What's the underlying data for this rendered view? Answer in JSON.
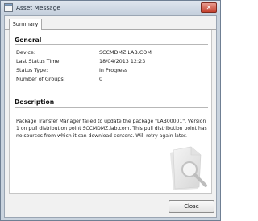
{
  "window": {
    "title": "Asset Message"
  },
  "tabs": [
    {
      "label": "Summary"
    }
  ],
  "general": {
    "heading": "General",
    "fields": [
      {
        "label": "Device:",
        "value": "SCCMDMZ.LAB.COM"
      },
      {
        "label": "Last Status Time:",
        "value": "18/04/2013 12:23"
      },
      {
        "label": "Status Type:",
        "value": "In Progress"
      },
      {
        "label": "Number of Groups:",
        "value": "0"
      }
    ]
  },
  "description": {
    "heading": "Description",
    "text": "Package Transfer Manager failed to update the package \"LAB00001\", Version 1 on pull distribution point SCCMDMZ.lab.com. This pull distribution point has no sources from which it can download content. Will retry again later."
  },
  "footer": {
    "close_label": "Close"
  },
  "icons": {
    "app": "window-icon",
    "titlebar_close": "close-icon",
    "watermark": "magnifier-document-icon"
  }
}
